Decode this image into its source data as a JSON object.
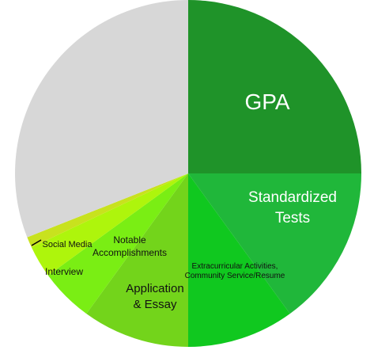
{
  "chart_data": {
    "type": "pie",
    "title": "",
    "start_angle_deg": 0,
    "direction": "clockwise",
    "slices": [
      {
        "key": "gpa",
        "label_lines": [
          "GPA"
        ],
        "value": 25.0,
        "color": "#1f9329"
      },
      {
        "key": "standardized-tests",
        "label_lines": [
          "Standardized",
          "Tests"
        ],
        "value": 15.0,
        "color": "#20b73a"
      },
      {
        "key": "extracurricular",
        "label_lines": [
          "Extracurricular Activities,",
          "Community Service/Resume"
        ],
        "value": 10.0,
        "color": "#10c81f"
      },
      {
        "key": "application-essay",
        "label_lines": [
          "Application",
          "& Essay"
        ],
        "value": 10.0,
        "color": "#73d41b"
      },
      {
        "key": "notable-accomplishments",
        "label_lines": [
          "Notable",
          "Accomplishments"
        ],
        "value": 5.0,
        "color": "#7aee14"
      },
      {
        "key": "interview",
        "label_lines": [
          "Interview"
        ],
        "value": 3.0,
        "color": "#aef50c"
      },
      {
        "key": "social-media",
        "label_lines": [
          "Social Media"
        ],
        "value": 1.0,
        "color": "#c8e21e"
      },
      {
        "key": "unlabeled-remainder",
        "label_lines": [],
        "value": 31.0,
        "color": "#d7d7d7"
      }
    ]
  }
}
